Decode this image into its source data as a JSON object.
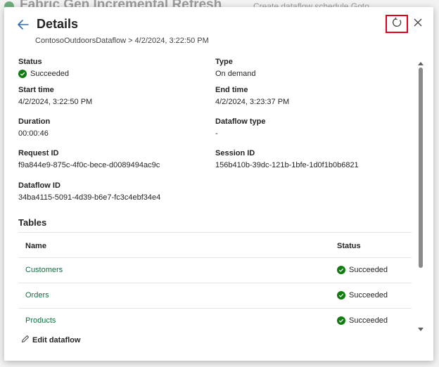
{
  "background": {
    "title": "Fabric Gen Incremental Refresh",
    "right_text": "Create dataflow schedule   Goto"
  },
  "dialog": {
    "title": "Details",
    "breadcrumb": "ContosoOutdoorsDataflow > 4/2/2024, 3:22:50 PM"
  },
  "fields": {
    "status": {
      "label": "Status",
      "value": "Succeeded"
    },
    "type": {
      "label": "Type",
      "value": "On demand"
    },
    "start_time": {
      "label": "Start time",
      "value": "4/2/2024, 3:22:50 PM"
    },
    "end_time": {
      "label": "End time",
      "value": "4/2/2024, 3:23:37 PM"
    },
    "duration": {
      "label": "Duration",
      "value": "00:00:46"
    },
    "dataflow_type": {
      "label": "Dataflow type",
      "value": "-"
    },
    "request_id": {
      "label": "Request ID",
      "value": "f9a844e9-875c-4f0c-bece-d0089494ac9c"
    },
    "session_id": {
      "label": "Session ID",
      "value": "156b410b-39dc-121b-1bfe-1d0f1b0b6821"
    },
    "dataflow_id": {
      "label": "Dataflow ID",
      "value": "34ba4115-5091-4d39-b6e7-fc3c4ebf34e4"
    }
  },
  "tables": {
    "heading": "Tables",
    "columns": {
      "name": "Name",
      "status": "Status"
    },
    "rows": [
      {
        "name": "Customers",
        "status": "Succeeded"
      },
      {
        "name": "Orders",
        "status": "Succeeded"
      },
      {
        "name": "Products",
        "status": "Succeeded"
      }
    ]
  },
  "actions": {
    "edit_dataflow": "Edit dataflow"
  },
  "icons": {
    "back": "back-arrow-icon",
    "refresh": "refresh-icon",
    "close": "close-icon",
    "success": "success-check-icon",
    "edit": "pencil-icon"
  },
  "colors": {
    "accent": "#2f6fb0",
    "success": "#107c10",
    "link": "#0f6f42",
    "highlight": "#e0001b"
  }
}
